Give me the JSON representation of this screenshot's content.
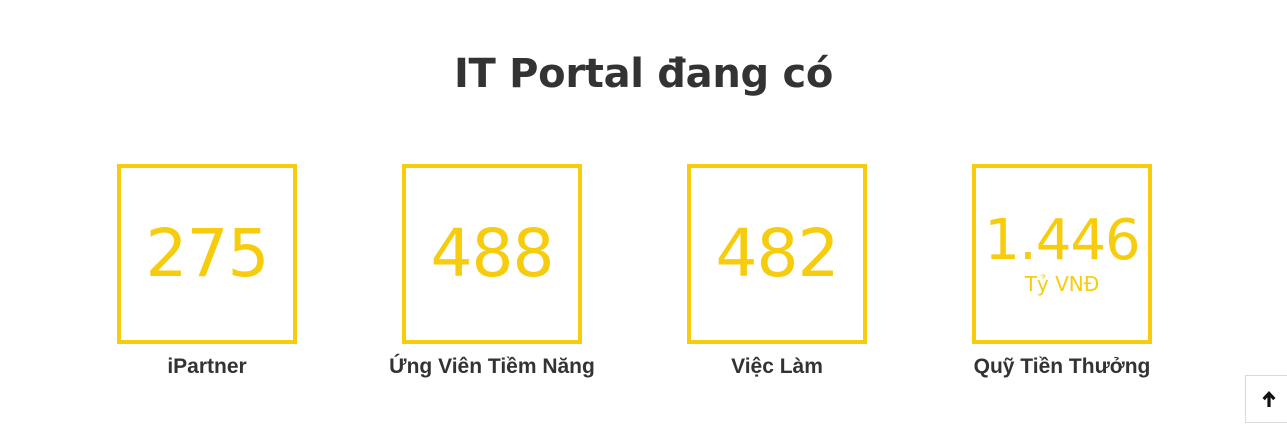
{
  "page": {
    "title": "IT Portal đang có"
  },
  "stats": [
    {
      "value": "275",
      "unit": "",
      "label": "iPartner"
    },
    {
      "value": "488",
      "unit": "",
      "label": "Ứng Viên Tiềm Năng"
    },
    {
      "value": "482",
      "unit": "",
      "label": "Việc Làm"
    },
    {
      "value": "1.446",
      "unit": "Tỷ VNĐ",
      "label": "Quỹ Tiền Thưởng"
    }
  ],
  "back_to_top": {
    "icon": "arrow-up-icon"
  },
  "colors": {
    "accent": "#f6cc0d",
    "text": "#333333",
    "background": "#ffffff"
  }
}
